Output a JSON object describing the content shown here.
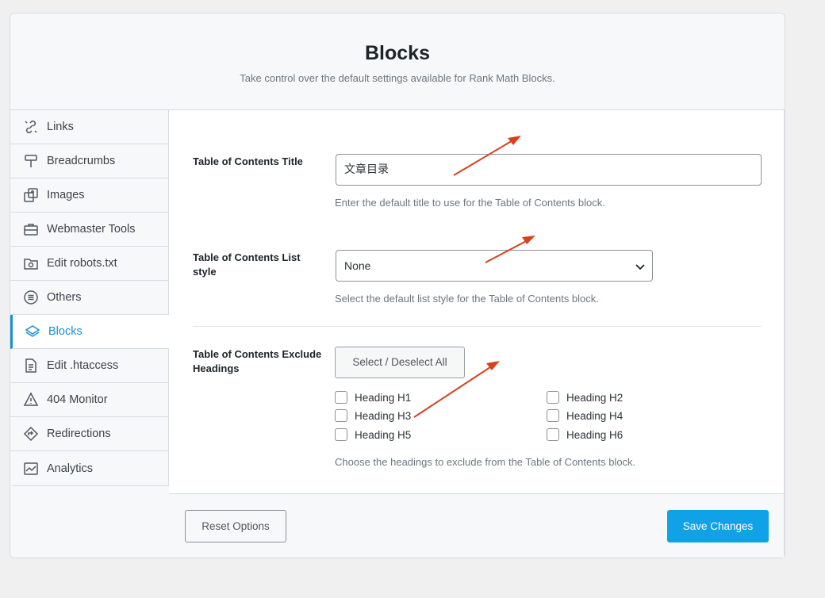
{
  "header": {
    "title": "Blocks",
    "subtitle": "Take control over the default settings available for Rank Math Blocks."
  },
  "sidebar": {
    "items": [
      {
        "label": "Links",
        "icon": "links-icon"
      },
      {
        "label": "Breadcrumbs",
        "icon": "breadcrumbs-icon"
      },
      {
        "label": "Images",
        "icon": "images-icon"
      },
      {
        "label": "Webmaster Tools",
        "icon": "briefcase-icon"
      },
      {
        "label": "Edit robots.txt",
        "icon": "robot-folder-icon"
      },
      {
        "label": "Others",
        "icon": "list-circle-icon"
      },
      {
        "label": "Blocks",
        "icon": "blocks-icon",
        "active": true
      },
      {
        "label": "Edit .htaccess",
        "icon": "file-icon"
      },
      {
        "label": "404 Monitor",
        "icon": "warning-icon"
      },
      {
        "label": "Redirections",
        "icon": "redirect-icon"
      },
      {
        "label": "Analytics",
        "icon": "analytics-icon"
      }
    ]
  },
  "fields": {
    "toc_title": {
      "label": "Table of Contents Title",
      "value": "文章目录",
      "description": "Enter the default title to use for the Table of Contents block."
    },
    "toc_list_style": {
      "label": "Table of Contents List style",
      "value": "None",
      "description": "Select the default list style for the Table of Contents block."
    },
    "toc_exclude": {
      "label": "Table of Contents Exclude Headings",
      "select_all_label": "Select / Deselect All",
      "options": [
        "Heading H1",
        "Heading H2",
        "Heading H3",
        "Heading H4",
        "Heading H5",
        "Heading H6"
      ],
      "description": "Choose the headings to exclude from the Table of Contents block."
    }
  },
  "footer": {
    "reset_label": "Reset Options",
    "save_label": "Save Changes"
  },
  "colors": {
    "accent": "#1a8fd1",
    "save_button": "#10a2e6",
    "annotation_arrow": "#d9401f"
  }
}
